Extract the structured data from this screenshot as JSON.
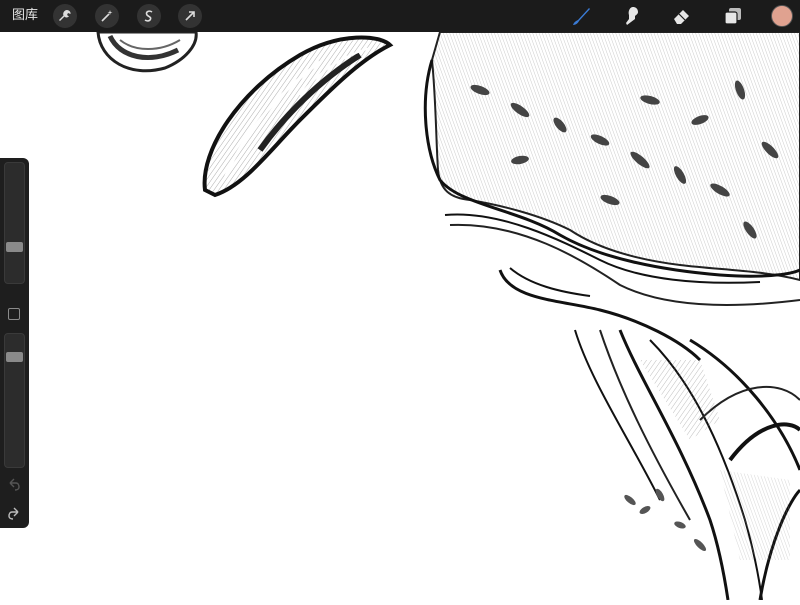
{
  "toolbar": {
    "gallery_label": "图库",
    "left_icons": [
      "wrench-icon",
      "magic-wand-icon",
      "selection-icon",
      "transform-arrow-icon"
    ],
    "right_icons": [
      "brush-icon",
      "smudge-icon",
      "eraser-icon",
      "layers-icon"
    ],
    "active_tool": "brush",
    "active_color": "#e0a290"
  },
  "sidebar": {
    "brush_size_level": 0.28,
    "opacity_level": 0.86
  },
  "colors": {
    "toolbar_bg": "#1b1b1b",
    "active_tool_accent": "#3a7bd5"
  }
}
